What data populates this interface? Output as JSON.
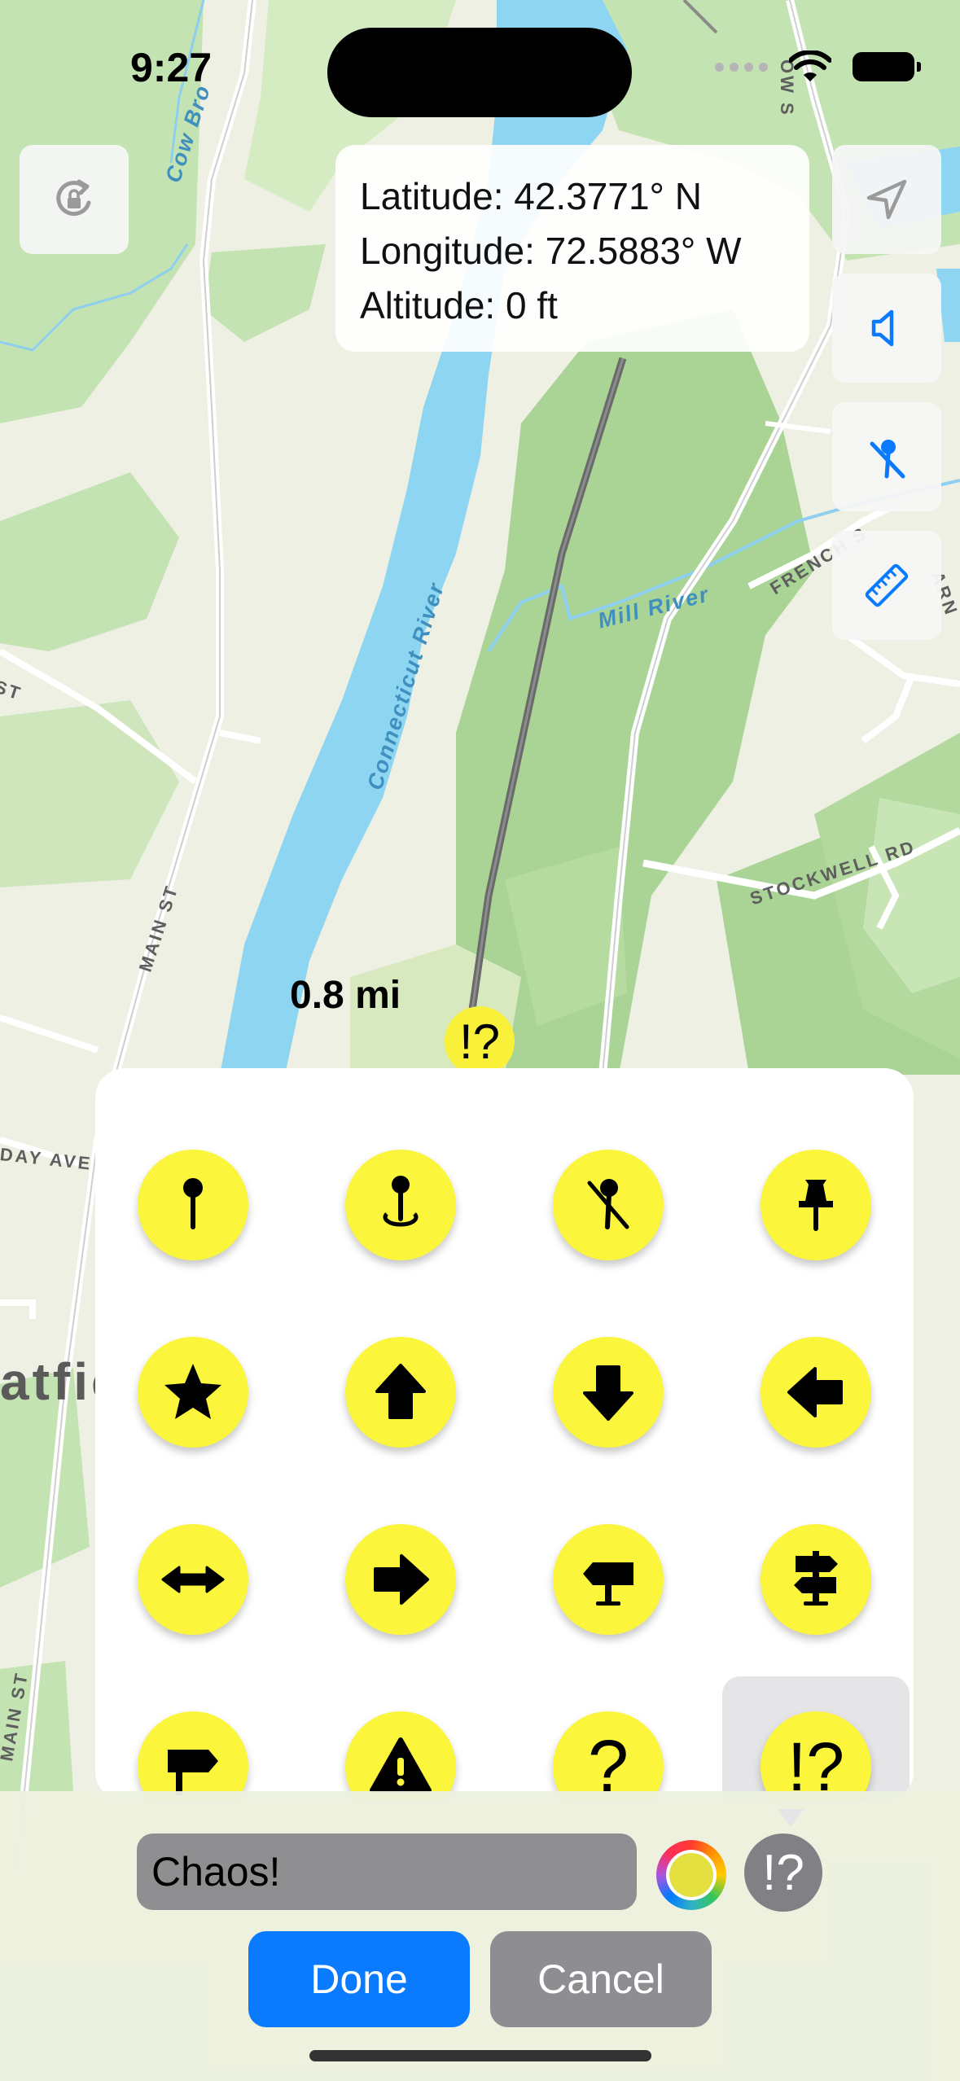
{
  "status_bar": {
    "time": "9:27",
    "icons": [
      "cellular-signal-icon",
      "wifi-icon",
      "battery-icon"
    ]
  },
  "map": {
    "labels": {
      "river_main": "Connecticut River",
      "river_mill": "Mill River",
      "brook": "Cow Bro",
      "road_main_upper": "MAIN ST",
      "road_main_lower": "MAIN ST",
      "road_stockwell": "STOCKWELL RD",
      "road_french": "FRENCH S",
      "road_left_st": "ST",
      "road_day_ave": "DAY AVE",
      "road_right_top": "OW S",
      "road_right_arn": "ARN",
      "town": "atfie"
    },
    "distance": "0.8 mi",
    "marker_symbol": "!?"
  },
  "coordinates": {
    "latitude": "Latitude: 42.3771° N",
    "longitude": "Longitude: 72.5883° W",
    "altitude": "Altitude: 0 ft"
  },
  "controls": {
    "left": [
      "rotate-lock-icon"
    ],
    "right": [
      "location-arrow-icon",
      "speaker-icon",
      "pin-slash-icon",
      "ruler-icon"
    ]
  },
  "symbol_picker": {
    "items": [
      {
        "name": "pin",
        "icon": "mappin-icon"
      },
      {
        "name": "pin-and-ellipse",
        "icon": "mappin-and-ellipse-icon"
      },
      {
        "name": "pin-slash",
        "icon": "mappin-slash-icon"
      },
      {
        "name": "pushpin",
        "icon": "pushpin-icon"
      },
      {
        "name": "star",
        "icon": "star-icon"
      },
      {
        "name": "arrow-up",
        "icon": "arrow-up-icon"
      },
      {
        "name": "arrow-down",
        "icon": "arrow-down-icon"
      },
      {
        "name": "arrow-left",
        "icon": "arrow-left-icon"
      },
      {
        "name": "arrow-left-right",
        "icon": "arrow-left-right-icon"
      },
      {
        "name": "arrow-right",
        "icon": "arrow-right-icon"
      },
      {
        "name": "signpost-left",
        "icon": "signpost-left-icon"
      },
      {
        "name": "signpost-right-left",
        "icon": "signpost-right-left-icon"
      },
      {
        "name": "signpost-right",
        "icon": "signpost-right-icon"
      },
      {
        "name": "warning",
        "icon": "warning-triangle-icon"
      },
      {
        "name": "question",
        "icon": "question-mark-icon",
        "text": "?"
      },
      {
        "name": "interrobang",
        "icon": "interrobang-icon",
        "text": "!?",
        "selected": true
      }
    ],
    "fill_color": "#fbf53c"
  },
  "editor": {
    "name_value": "Chaos!",
    "selected_symbol": "!?",
    "color_swatch": "#e3e040",
    "done_label": "Done",
    "cancel_label": "Cancel"
  }
}
